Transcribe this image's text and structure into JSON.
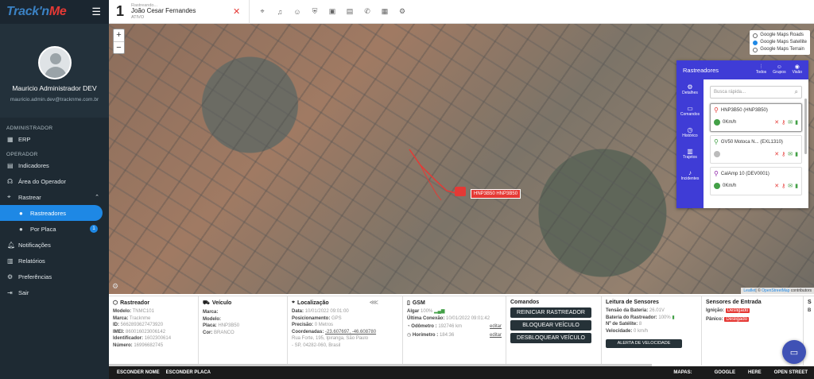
{
  "sidebar": {
    "brand": {
      "logo_a": "Track'n",
      "logo_b": "Me"
    },
    "profile": {
      "name": "Mauricio Administrador DEV",
      "email": "mauricio.admin.dev@tracknme.com.br"
    },
    "sections": {
      "admin": "ADMINISTRADOR",
      "operator": "OPERADOR"
    },
    "items": {
      "erp": "ERP",
      "indicadores": "Indicadores",
      "area": "Área do Operador",
      "rastrear": "Rastrear",
      "rastreadores": "Rastreadores",
      "porplaca": "Por Placa",
      "porplaca_badge": "1",
      "notificacoes": "Notificações",
      "relatorios": "Relatórios",
      "preferencias": "Preferências",
      "sair": "Sair"
    }
  },
  "topbar": {
    "count": "1",
    "label": "Rastreando...",
    "name": "João Cesar Fernandes",
    "status": "ATIVO"
  },
  "map": {
    "zoom_in": "+",
    "zoom_out": "−",
    "layers": [
      {
        "label": "Google Maps Roads",
        "selected": false
      },
      {
        "label": "Google Maps Satellite",
        "selected": true
      },
      {
        "label": "Google Maps Terrain",
        "selected": false
      }
    ],
    "vehicle_label": "HNP3B50 HNP3B50",
    "attribution_a": "Leaflet",
    "attribution_b": "| © ",
    "attribution_c": "OpenStreetMap",
    "attribution_d": " contributors"
  },
  "trackers": {
    "title": "Rastreadores",
    "tabs": [
      "Todos",
      "Grupos",
      "Visão"
    ],
    "side": [
      "Detalhes",
      "Comandos",
      "Histórico",
      "Trajetos",
      "Incidentes"
    ],
    "search_placeholder": "Busca rápida...",
    "items": [
      {
        "name": "HNP3B50 (HNP3B50)",
        "speed": "0Km/h",
        "pin_color": "#e53935",
        "online": true
      },
      {
        "name": "GV50 Motoca N... (EXL1310)",
        "speed": "",
        "pin_color": "#43a047",
        "online": false
      },
      {
        "name": "CalAmp 10 (DEV0001)",
        "speed": "0Km/h",
        "pin_color": "#8e24aa",
        "online": true
      }
    ]
  },
  "panels": {
    "rastreador": {
      "title": "Rastreador",
      "modelo_k": "Modelo:",
      "modelo_v": "TNMC101",
      "marca_k": "Marca:",
      "marca_v": "Tracknme",
      "id_k": "ID:",
      "id_v": "5662893627473920",
      "imei_k": "IMEI:",
      "imei_v": "860016023006142",
      "ident_k": "Identificador:",
      "ident_v": "1602300614",
      "num_k": "Número:",
      "num_v": "16996682745"
    },
    "veiculo": {
      "title": "Veículo",
      "marca_k": "Marca:",
      "marca_v": "",
      "modelo_k": "Modelo:",
      "modelo_v": "",
      "placa_k": "Placa:",
      "placa_v": "HNP3B50",
      "cor_k": "Cor:",
      "cor_v": "BRANCO"
    },
    "localizacao": {
      "title": "Localização",
      "data_k": "Data:",
      "data_v": "10/01/2022 09:01:00",
      "pos_k": "Posicionamento:",
      "pos_v": "GPS",
      "prec_k": "Precisão:",
      "prec_v": "0 Metros",
      "coord_k": "Coordenadas:",
      "coord_v": "-23.607697, -46.608780",
      "addr1": "Rua Forte, 195, Ipiranga, São Paulo",
      "addr2": "- SP, 04282-060, Brasil"
    },
    "gsm": {
      "title": "GSM",
      "algar_k": "Algar",
      "algar_v": "100%",
      "ult_k": "Última Conexão:",
      "ult_v": "10/01/2022 09:01:42",
      "odo_k": "Odômetro :",
      "odo_v": "192746 km",
      "odo_edit": "editar",
      "hor_k": "Horímetro :",
      "hor_v": "184:36",
      "hor_edit": "editar"
    },
    "comandos": {
      "title": "Comandos",
      "reiniciar": "REINICIAR RASTREADOR",
      "bloquear": "BLOQUEAR VEÍCULO",
      "desbloquear": "DESBLOQUEAR VEÍCULO"
    },
    "sensores": {
      "title": "Leitura de Sensores",
      "tensao_k": "Tensão da Bateria:",
      "tensao_v": "26.01V",
      "bat_k": "Bateria do Rastreador:",
      "bat_v": "100%",
      "sat_k": "Nº de Satélite:",
      "sat_v": "8",
      "vel_k": "Velocidade:",
      "vel_v": "0 km/h",
      "alerta": "ALERTA DE VELOCIDADE"
    },
    "entrada": {
      "title": "Sensores de Entrada",
      "ign_k": "Ignição:",
      "ign_v": "Desligado",
      "pan_k": "Pânico:",
      "pan_v": "Desligado"
    },
    "extra": {
      "title": "S",
      "row": "B"
    }
  },
  "footer": {
    "esconder_nome": "ESCONDER NOME",
    "esconder_placa": "ESCONDER PLACA",
    "mapas": "MAPAS:",
    "google": "GOOGLE",
    "here": "HERE",
    "osm": "OPEN STREET"
  }
}
